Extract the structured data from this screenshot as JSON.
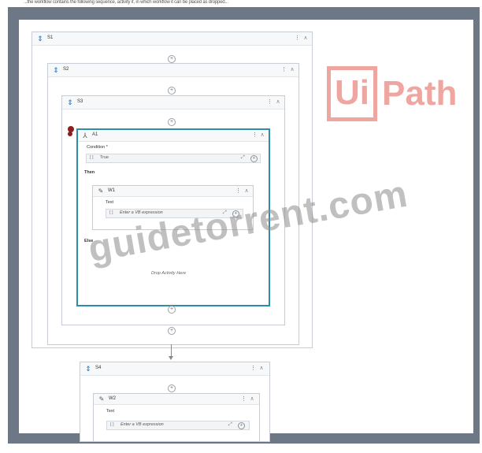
{
  "top_text": "...the workflow contains the following sequence, activity if, in which workflow it can be placed as dropped...",
  "sequences": {
    "s1": "S1",
    "s2": "S2",
    "s3": "S3",
    "s4": "S4"
  },
  "if_activity": {
    "title": "A1",
    "condition_label": "Condition *",
    "condition_value": "True",
    "then_label": "Then",
    "else_label": "Else",
    "drop_text": "Drop Activity Here"
  },
  "write_line_1": {
    "title": "W1",
    "text_label": "Text",
    "placeholder": "Enter a VB expression"
  },
  "write_line_2": {
    "title": "W2",
    "text_label": "Text",
    "placeholder": "Enter a VB expression"
  },
  "glyphs": {
    "vb": "[ ]",
    "expand": "⤢",
    "more": "⋮",
    "collapse": "∧",
    "add": "+",
    "ellipsis_btn": "…"
  },
  "logo": {
    "box_text": "Ui",
    "text": "Path"
  },
  "watermark": "guidetorrent.com",
  "colors": {
    "frame": "#6e7785",
    "selected_border": "#2c8fa6",
    "logo": "#f0a6a0"
  }
}
